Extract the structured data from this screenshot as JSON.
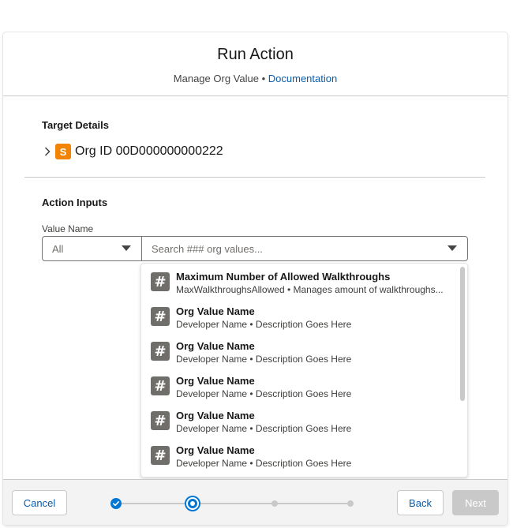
{
  "header": {
    "title": "Run Action",
    "subtitle_prefix": "Manage Org Value",
    "separator": "•",
    "link_label": "Documentation"
  },
  "target": {
    "section_title": "Target Details",
    "badge_letter": "S",
    "org_label": "Org ID 00D000000000222"
  },
  "inputs": {
    "section_title": "Action Inputs",
    "field_label": "Value Name",
    "filter_value": "All",
    "search_placeholder": "Search ### org values..."
  },
  "dropdown": {
    "icon_glyph": "#",
    "items": [
      {
        "title": "Maximum Number of Allowed Walkthroughs",
        "subtitle": "MaxWalkthroughsAllowed • Manages amount of walkthroughs..."
      },
      {
        "title": "Org Value Name",
        "subtitle": "Developer Name • Description Goes Here"
      },
      {
        "title": "Org Value Name",
        "subtitle": "Developer Name • Description Goes Here"
      },
      {
        "title": "Org Value Name",
        "subtitle": "Developer Name • Description Goes Here"
      },
      {
        "title": "Org Value Name",
        "subtitle": "Developer Name • Description Goes Here"
      },
      {
        "title": "Org Value Name",
        "subtitle": "Developer Name • Description Goes Here"
      }
    ]
  },
  "footer": {
    "cancel_label": "Cancel",
    "back_label": "Back",
    "next_label": "Next",
    "progress": {
      "total_steps": 4,
      "current_step": 2
    }
  },
  "colors": {
    "brand": "#0176d3",
    "link": "#0b5cab",
    "org_badge": "#f38303",
    "hash_icon": "#706e6b",
    "disabled": "#c9c9c9"
  },
  "icons": [
    "chevron-right-icon",
    "salesforce-org-icon",
    "chevron-down-icon",
    "hash-icon",
    "check-icon"
  ]
}
